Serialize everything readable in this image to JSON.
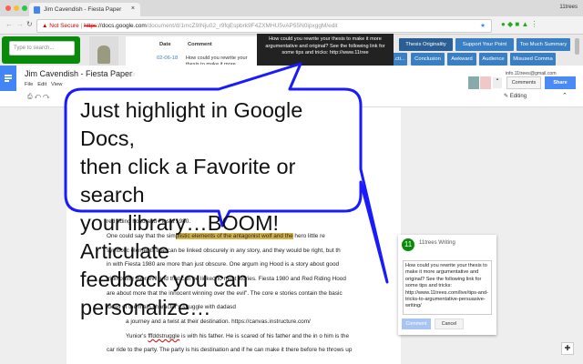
{
  "browser": {
    "tab_title": "Jim Cavendish - Fiesta Paper",
    "profile": "11trees",
    "security": "Not Secure",
    "url_scheme": "https",
    "url_host": "://docs.google.com",
    "url_path": "/document/d/1mcZ9INju02_r9fqEspbrk9F4ZXMHU5vAP55N0ipxggM/edit"
  },
  "extension": {
    "search_placeholder": "Type to search...",
    "table_headers": [
      "Date",
      "Comment"
    ],
    "row": {
      "date": "02-06-18",
      "comment": "How could you rewrite your thesis to make it more argumentative and original? See the following link"
    },
    "tooltip": "How could you rewrite your thesis to make it more argumentative and original? See the following link for some tips and tricks: http://www.11tree",
    "buttons_row1": [
      "Thesis Originality",
      "Support Your Point",
      "Too Much Summary"
    ],
    "buttons_row2": [
      "...cti...",
      "Conclusion",
      "Awkward",
      "Audience",
      "Misused Comma"
    ]
  },
  "docs": {
    "title": "Jim Cavendish - Fiesta Paper",
    "menus": [
      "File",
      "Edit",
      "View"
    ],
    "account": "info.11trees@gmail.com",
    "comments_label": "Comments",
    "share_label": "Share",
    "mode_label": "Editing"
  },
  "callout": {
    "lines": [
      "Just highlight in Google Docs,",
      "then click a Favorite or search",
      "your library…BOOM! Articulate",
      "feedback you can personalize…"
    ]
  },
  "document": {
    "lines": [
      "red riding hood and Fiesta 1980.",
      "One could say that the sim",
      "plistic elements of the antagonist wolf and the",
      " hero little re",
      "symbolic elements that can be linked obscurely in any story, and they would be right, but th",
      "in with Fiesta 1980 are more than just obscure. One argum ing Hood is a story about good",
      "triumphing over evil and that can be linked to most stories. Fiesta 1980 and Red Riding Hood",
      "are about more that the innocent winning over the evil\". The core e  stories contain the basic",
      "ideas of the main character's struggle with dadasd",
      "a journey and a twist at their destination. https://canvas.instructure.com/",
      "Yunior's ",
      "fffddstruggle",
      " is with his father. He is scared of his father and the in o him is the",
      "car ride to the party. The party is his destination and if he can make it there before he throws up"
    ]
  },
  "comment_card": {
    "author": "11trees Writing",
    "avatar": "11",
    "text": "How could you rewrite your thesis to make it more argumentative and original? See the following link for some tips and tricks: http://www.11trees.com/live/tips-and-tricks-to-argumentative-persuasive-writing/",
    "comment_button": "Comment",
    "cancel_button": "Cancel"
  }
}
